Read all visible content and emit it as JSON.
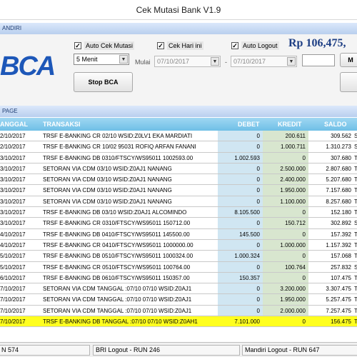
{
  "window": {
    "title": "Cek Mutasi Bank V1.9"
  },
  "section_top": {
    "title": "ANDIRI"
  },
  "controls": {
    "auto_cek_label": "Auto Cek Mutasi",
    "cek_hari_ini_label": "Cek Hari ini",
    "auto_logout_label": "Auto Logout",
    "interval_value": "5 Menit",
    "mulai_label": "Mulai",
    "date_from": "07/10/2017",
    "date_sep": "-",
    "date_to": "07/10/2017",
    "stop_button": "Stop BCA",
    "right_button_partial": "M"
  },
  "bank": {
    "logo_text": "BCA",
    "balance": "Rp 106,475,"
  },
  "section_grid": {
    "title": "PAGE"
  },
  "grid": {
    "headers": {
      "tanggal": "ANGGAL",
      "transaksi": "TRANSAKSI",
      "debet": "DEBET",
      "kredit": "KREDIT",
      "saldo": "SALDO"
    },
    "rows": [
      {
        "tgl": "2/10/2017",
        "transaksi": "TRSF E-BANKING CR  02/10 WSID:Z0LV1  EKA MARDIATI",
        "debet": "0",
        "kredit": "200.611",
        "saldo": "309.562",
        "x": "S"
      },
      {
        "tgl": "2/10/2017",
        "transaksi": "TRSF E-BANKING CR  10/02 95031  ROFIQ ARFAN FANANI",
        "debet": "0",
        "kredit": "1.000.711",
        "saldo": "1.310.273",
        "x": "S"
      },
      {
        "tgl": "3/10/2017",
        "transaksi": "TRSF E-BANKING DB  0310/FTSCY/WS95011 1002593.00",
        "debet": "1.002.593",
        "kredit": "0",
        "saldo": "307.680",
        "x": "T"
      },
      {
        "tgl": "3/10/2017",
        "transaksi": "SETORAN VIA CDM  03/10 WSID:Z0AJ1 NANANG",
        "debet": "0",
        "kredit": "2.500.000",
        "saldo": "2.807.680",
        "x": "T"
      },
      {
        "tgl": "3/10/2017",
        "transaksi": "SETORAN VIA CDM  03/10 WSID:Z0AJ1 NANANG",
        "debet": "0",
        "kredit": "2.400.000",
        "saldo": "5.207.680",
        "x": "T"
      },
      {
        "tgl": "3/10/2017",
        "transaksi": "SETORAN VIA CDM  03/10 WSID:Z0AJ1 NANANG",
        "debet": "0",
        "kredit": "1.950.000",
        "saldo": "7.157.680",
        "x": "T"
      },
      {
        "tgl": "3/10/2017",
        "transaksi": "SETORAN VIA CDM  03/10 WSID:Z0AJ1 NANANG",
        "debet": "0",
        "kredit": "1.100.000",
        "saldo": "8.257.680",
        "x": "T"
      },
      {
        "tgl": "3/10/2017",
        "transaksi": "TRSF E-BANKING DB  03/10 WSID:Z0AJ1  ALCOMINDO",
        "debet": "8.105.500",
        "kredit": "0",
        "saldo": "152.180",
        "x": "T"
      },
      {
        "tgl": "3/10/2017",
        "transaksi": "TRSF E-BANKING CR  0310/FTSCY/WS95011 150712.00",
        "debet": "0",
        "kredit": "150.712",
        "saldo": "302.892",
        "x": "S"
      },
      {
        "tgl": "4/10/2017",
        "transaksi": "TRSF E-BANKING DB  0410/FTSCY/WS95011 145500.00",
        "debet": "145.500",
        "kredit": "0",
        "saldo": "157.392",
        "x": "T"
      },
      {
        "tgl": "4/10/2017",
        "transaksi": "TRSF E-BANKING CR  0410/FTSCY/WS95011 1000000.00",
        "debet": "0",
        "kredit": "1.000.000",
        "saldo": "1.157.392",
        "x": "T"
      },
      {
        "tgl": "5/10/2017",
        "transaksi": "TRSF E-BANKING DB  0510/FTSCY/WS95011 1000324.00",
        "debet": "1.000.324",
        "kredit": "0",
        "saldo": "157.068",
        "x": "T"
      },
      {
        "tgl": "5/10/2017",
        "transaksi": "TRSF E-BANKING CR  0510/FTSCY/WS95011 100764.00",
        "debet": "0",
        "kredit": "100.764",
        "saldo": "257.832",
        "x": "S"
      },
      {
        "tgl": "6/10/2017",
        "transaksi": "TRSF E-BANKING DB  0610/FTSCY/WS95011 150357.00",
        "debet": "150.357",
        "kredit": "0",
        "saldo": "107.475",
        "x": "T"
      },
      {
        "tgl": "7/10/2017",
        "transaksi": "SETORAN VIA CDM  TANGGAL :07/10 07/10 WSID:Z0AJ1",
        "debet": "0",
        "kredit": "3.200.000",
        "saldo": "3.307.475",
        "x": "T"
      },
      {
        "tgl": "7/10/2017",
        "transaksi": "SETORAN VIA CDM  TANGGAL :07/10 07/10 WSID:Z0AJ1",
        "debet": "0",
        "kredit": "1.950.000",
        "saldo": "5.257.475",
        "x": "T"
      },
      {
        "tgl": "7/10/2017",
        "transaksi": "SETORAN VIA CDM  TANGGAL :07/10 07/10 WSID:Z0AJ1",
        "debet": "0",
        "kredit": "2.000.000",
        "saldo": "7.257.475",
        "x": "T"
      },
      {
        "tgl": "7/10/2017",
        "transaksi": "TRSF E-BANKING DB  TANGGAL :07/10  07/10 WSID:Z0AH1",
        "debet": "7.101.000",
        "kredit": "0",
        "saldo": "156.475",
        "x": "T"
      }
    ]
  },
  "statusbar": {
    "seg1": "N 574",
    "seg2": "BRI Logout - RUN 246",
    "seg3": "Mandiri Logout - RUN 647"
  },
  "colors": {
    "header_blue": "#6fbfe6",
    "highlight": "#ffff1f",
    "logo_blue": "#1d57b8"
  }
}
